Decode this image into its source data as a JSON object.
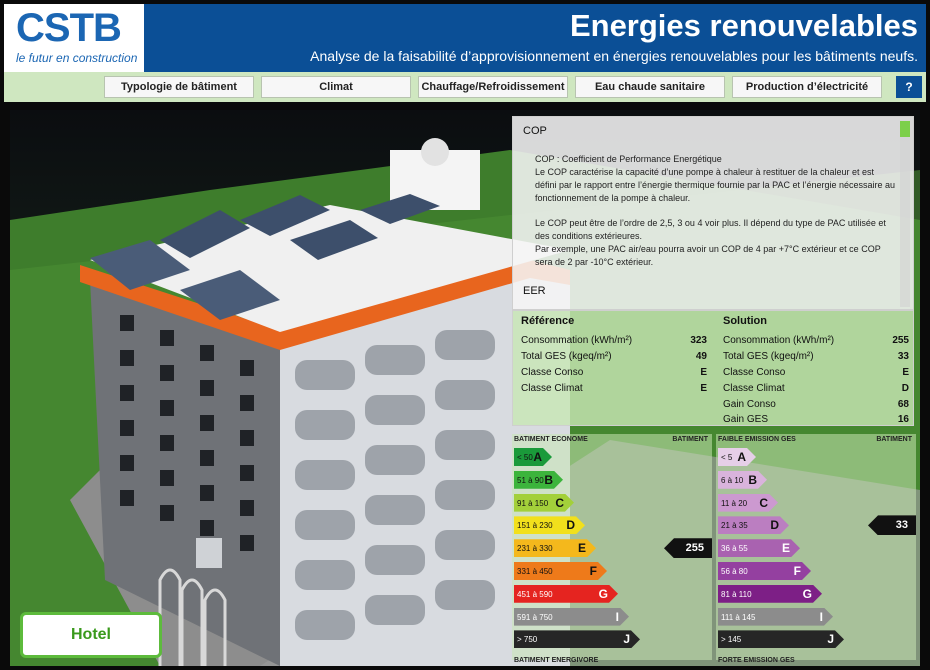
{
  "header": {
    "logo": "CSTB",
    "tagline": "le futur en construction",
    "title": "Energies renouvelables",
    "subtitle": "Analyse de la faisabilité d’approvisionnement en énergies renouvelables pour les bâtiments neufs."
  },
  "nav": {
    "items": [
      {
        "label": "Typologie de bâtiment"
      },
      {
        "label": "Climat"
      },
      {
        "label": "Chauffage/Refroidissement"
      },
      {
        "label": "Eau chaude sanitaire"
      },
      {
        "label": "Production d’électricité"
      }
    ],
    "help": "?"
  },
  "info": {
    "cop_heading": "COP",
    "cop_paragraphs": [
      "COP : Coefficient de Performance Energétique",
      "Le COP caractérise la capacité d’une pompe à chaleur à restituer de la chaleur et est défini par le rapport entre l’énergie thermique fournie par la PAC et l’énergie nécessaire au fonctionnement de la pompe à chaleur.",
      "",
      "Le COP peut être de l’ordre de 2,5, 3 ou 4 voir plus. Il dépend du type de PAC utilisée et des conditions extérieures.",
      "Par exemple, une PAC air/eau pourra avoir un COP de 4 par +7°C extérieur et ce COP sera de 2 par -10°C extérieur."
    ],
    "eer_heading": "EER"
  },
  "reference": {
    "title": "Référence",
    "rows": [
      {
        "label": "Consommation (kWh/m²)",
        "value": "323"
      },
      {
        "label": "Total GES (kgeq/m²)",
        "value": "49"
      },
      {
        "label": "Classe Conso",
        "value": "E"
      },
      {
        "label": "Classe Climat",
        "value": "E"
      }
    ]
  },
  "solution": {
    "title": "Solution",
    "rows": [
      {
        "label": "Consommation (kWh/m²)",
        "value": "255"
      },
      {
        "label": "Total GES (kgeq/m²)",
        "value": "33"
      },
      {
        "label": "Classe Conso",
        "value": "E"
      },
      {
        "label": "Classe Climat",
        "value": "D"
      },
      {
        "label": "Gain Conso",
        "value": "68"
      },
      {
        "label": "Gain GES",
        "value": "16"
      }
    ]
  },
  "energy_label": {
    "header": "BATIMENT ECONOME",
    "column": "BATIMENT",
    "footer": "BATIMENT ENERGIVORE",
    "marker": "255",
    "marker_grade": "E",
    "grades": [
      {
        "range": "< 50",
        "letter": "A",
        "color": "#1a9a3a"
      },
      {
        "range": "51 à 90",
        "letter": "B",
        "color": "#3cb43c"
      },
      {
        "range": "91 à 150",
        "letter": "C",
        "color": "#a3d03a"
      },
      {
        "range": "151 à 230",
        "letter": "D",
        "color": "#f2e01c"
      },
      {
        "range": "231 à 330",
        "letter": "E",
        "color": "#f4b81c"
      },
      {
        "range": "331 à 450",
        "letter": "F",
        "color": "#ee7a1a"
      },
      {
        "range": "451 à 590",
        "letter": "G",
        "color": "#e52420"
      },
      {
        "range": "591 à 750",
        "letter": "I",
        "color": "#8c8c8c"
      },
      {
        "range": "> 750",
        "letter": "J",
        "color": "#262626"
      }
    ]
  },
  "ges_label": {
    "header": "FAIBLE EMISSION GES",
    "column": "BATIMENT",
    "footer": "FORTE EMISSION GES",
    "marker": "33",
    "marker_grade": "D",
    "grades": [
      {
        "range": "< 5",
        "letter": "A",
        "color": "#e6cfe8"
      },
      {
        "range": "6 à 10",
        "letter": "B",
        "color": "#d9b3dc"
      },
      {
        "range": "11 à 20",
        "letter": "C",
        "color": "#cc99d0"
      },
      {
        "range": "21 à 35",
        "letter": "D",
        "color": "#bb7ec1"
      },
      {
        "range": "36 à 55",
        "letter": "E",
        "color": "#a962b0"
      },
      {
        "range": "56 à 80",
        "letter": "F",
        "color": "#9440a0"
      },
      {
        "range": "81 à 110",
        "letter": "G",
        "color": "#7d1f86"
      },
      {
        "range": "111 à 145",
        "letter": "I",
        "color": "#8c8c8c"
      },
      {
        "range": "> 145",
        "letter": "J",
        "color": "#262626"
      }
    ]
  },
  "building": {
    "name": "Hotel"
  },
  "colors": {
    "header_blue": "#0b4f96",
    "nav_green": "#cfe7c0",
    "accent_green": "#5dbb3c",
    "roof_orange": "#e8651e"
  }
}
